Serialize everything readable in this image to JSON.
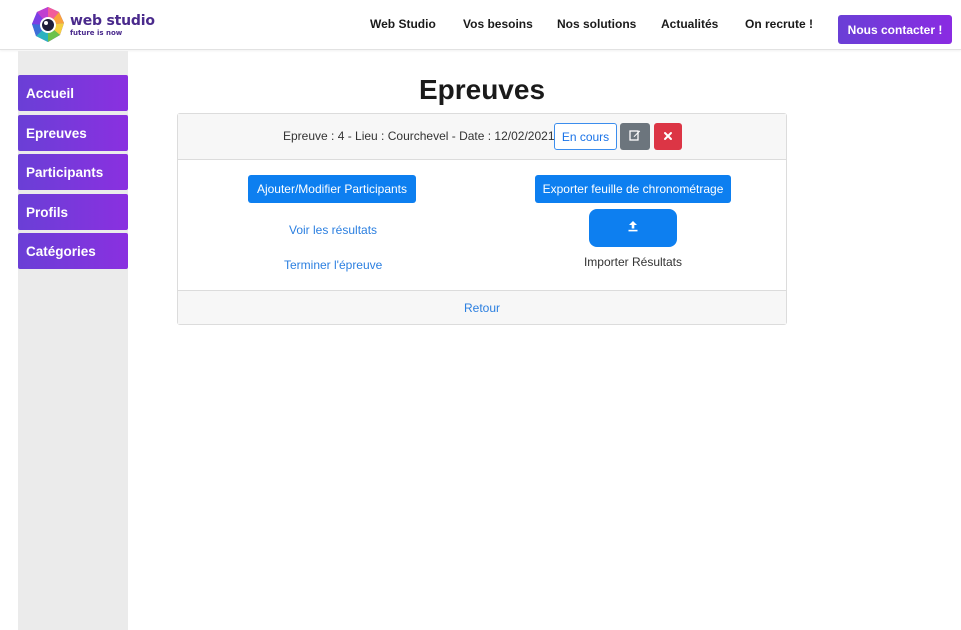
{
  "brand": {
    "name": "web studio",
    "tagline": "future is now"
  },
  "nav": {
    "items": [
      {
        "label": "Web Studio"
      },
      {
        "label": "Vos besoins"
      },
      {
        "label": "Nos solutions"
      },
      {
        "label": "Actualités"
      },
      {
        "label": "On recrute !"
      }
    ],
    "contact_label": "Nous contacter !"
  },
  "sidebar": {
    "items": [
      {
        "label": "Accueil"
      },
      {
        "label": "Epreuves"
      },
      {
        "label": "Participants"
      },
      {
        "label": "Profils"
      },
      {
        "label": "Catégories"
      }
    ]
  },
  "page": {
    "title": "Epreuves"
  },
  "card": {
    "info_line": "Epreuve : 4 - Lieu : Courchevel - Date : 12/02/2021 -",
    "status_label": "En cours",
    "edit_icon": "edit-icon",
    "delete_icon": "close-icon",
    "left_column": {
      "add_participants_label": "Ajouter/Modifier Participants",
      "view_results_label": "Voir les résultats",
      "finish_label": "Terminer l'épreuve"
    },
    "right_column": {
      "export_label": "Exporter feuille de chronométrage",
      "upload_icon": "upload-icon",
      "import_label": "Importer Résultats"
    },
    "footer_link": "Retour"
  },
  "colors": {
    "accent_purple": "#7a35e0",
    "primary_blue": "#0d7ff0",
    "danger_red": "#dc3545",
    "secondary_gray": "#6c757d",
    "link_blue": "#2b7fe0"
  }
}
